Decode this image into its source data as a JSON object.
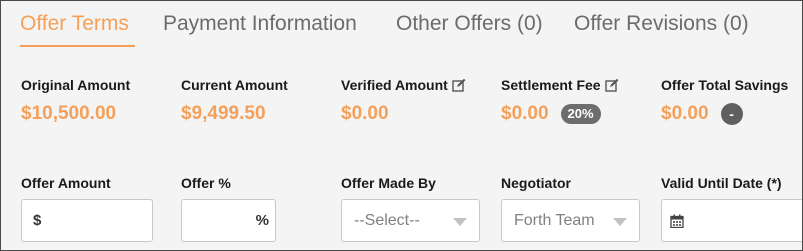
{
  "tabs": [
    {
      "label": "Offer Terms",
      "active": true
    },
    {
      "label": "Payment Information"
    },
    {
      "label": "Other Offers (0)"
    },
    {
      "label": "Offer Revisions (0)"
    }
  ],
  "summary": {
    "original_amount": {
      "label": "Original Amount",
      "value": "$10,500.00"
    },
    "current_amount": {
      "label": "Current Amount",
      "value": "$9,499.50"
    },
    "verified_amount": {
      "label": "Verified Amount",
      "value": "$0.00",
      "icon": "edit-icon"
    },
    "settlement_fee": {
      "label": "Settlement Fee",
      "value": "$0.00",
      "icon": "edit-icon",
      "badge": "20%"
    },
    "offer_total_savings": {
      "label": "Offer Total Savings",
      "value": "$0.00",
      "badge": "-"
    }
  },
  "form": {
    "offer_amount": {
      "label": "Offer Amount",
      "prefix": "$",
      "value": ""
    },
    "offer_percent": {
      "label": "Offer %",
      "suffix": "%",
      "value": ""
    },
    "offer_made_by": {
      "label": "Offer Made By",
      "selected": "--Select--"
    },
    "negotiator": {
      "label": "Negotiator",
      "selected": "Forth Team"
    },
    "valid_until": {
      "label": "Valid Until Date (*)",
      "icon": "calendar-icon",
      "value": ""
    }
  },
  "colors": {
    "accent": "#f5a05a",
    "badge": "#6d6d6d",
    "background": "#f4f4f4"
  }
}
